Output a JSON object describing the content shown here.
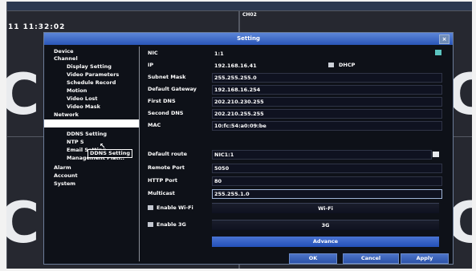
{
  "background": {
    "timestamp": "11 11:32:02",
    "channel_label": "CH02"
  },
  "dialog": {
    "title": "Setting",
    "close_glyph": "×"
  },
  "sidebar": {
    "items": [
      {
        "label": "Device",
        "level": 0
      },
      {
        "label": "Channel",
        "level": 0
      },
      {
        "label": "Display Setting",
        "level": 2
      },
      {
        "label": "Video Parameters",
        "level": 2
      },
      {
        "label": "Schedule Record",
        "level": 2
      },
      {
        "label": "Motion",
        "level": 2
      },
      {
        "label": "Video Lost",
        "level": 2
      },
      {
        "label": "Video Mask",
        "level": 2
      },
      {
        "label": "Network",
        "level": 0
      },
      {
        "label": "",
        "level": 0,
        "selected": true
      },
      {
        "label": "DDNS Setting",
        "level": 2
      },
      {
        "label": "NTP S",
        "level": 2
      },
      {
        "label": "Email Setting",
        "level": 2
      },
      {
        "label": "Management Platf..",
        "level": 2
      },
      {
        "label": "Alarm",
        "level": 0
      },
      {
        "label": "Account",
        "level": 0
      },
      {
        "label": "System",
        "level": 0
      }
    ],
    "tooltip": "DDNS Setting"
  },
  "network": {
    "nic_label": "NIC",
    "nic_value": "1:1",
    "ip_label": "IP",
    "ip_value": "192.168.16.41",
    "dhcp_label": "DHCP",
    "dhcp_checked": true,
    "subnet_label": "Subnet Mask",
    "subnet_value": "255.255.255.0",
    "gateway_label": "Default Gateway",
    "gateway_value": "192.168.16.254",
    "dns1_label": "First DNS",
    "dns1_value": "202.210.230.255",
    "dns2_label": "Second DNS",
    "dns2_value": "202.210.255.255",
    "mac_label": "MAC",
    "mac_value": "10:fc:54:a0:09:be",
    "route_label": "Default route",
    "route_value": "NIC1:1",
    "remote_port_label": "Remote Port",
    "remote_port_value": "5050",
    "http_port_label": "HTTP Port",
    "http_port_value": "80",
    "multicast_label": "Multicast",
    "multicast_value": "255.255.1.0",
    "wifi_label": "Enable Wi-Fi",
    "wifi_button": "Wi-Fi",
    "g3_label": "Enable 3G",
    "g3_button": "3G",
    "advance_button": "Advance"
  },
  "buttons": {
    "ok": "OK",
    "cancel": "Cancel",
    "apply": "Apply"
  },
  "colors": {
    "titlebar": "#3a66c8",
    "dialog_bg": "#0e1118",
    "button": "#2c52a8"
  }
}
